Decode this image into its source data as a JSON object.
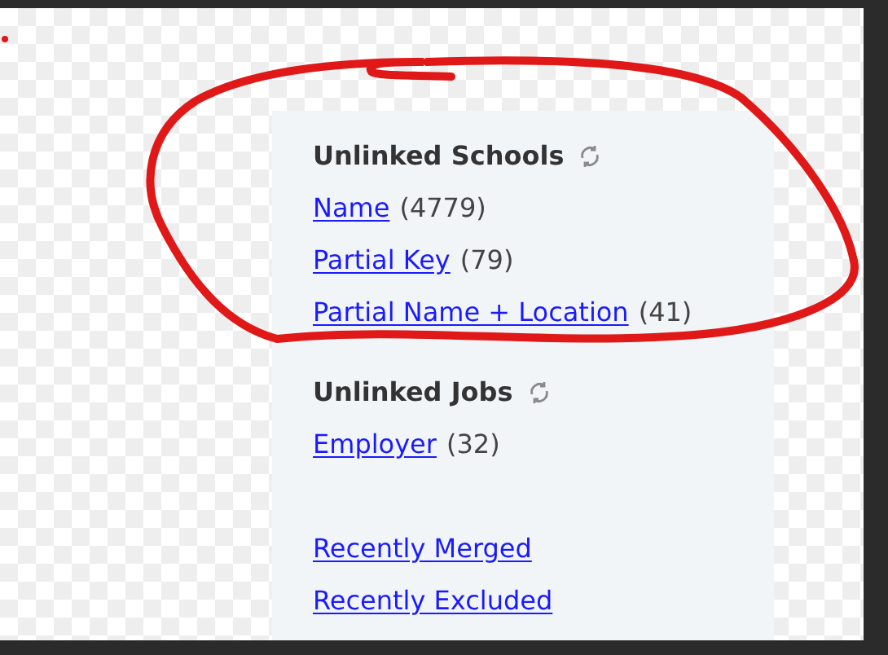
{
  "sections": [
    {
      "heading": "Unlinked Schools",
      "items": [
        {
          "label": "Name",
          "count": "(4779)"
        },
        {
          "label": "Partial Key",
          "count": "(79)"
        },
        {
          "label": "Partial Name + Location",
          "count": "(41)"
        }
      ]
    },
    {
      "heading": "Unlinked Jobs",
      "items": [
        {
          "label": "Employer",
          "count": "(32)"
        }
      ]
    }
  ],
  "links": [
    "Recently Merged",
    "Recently Excluded"
  ]
}
